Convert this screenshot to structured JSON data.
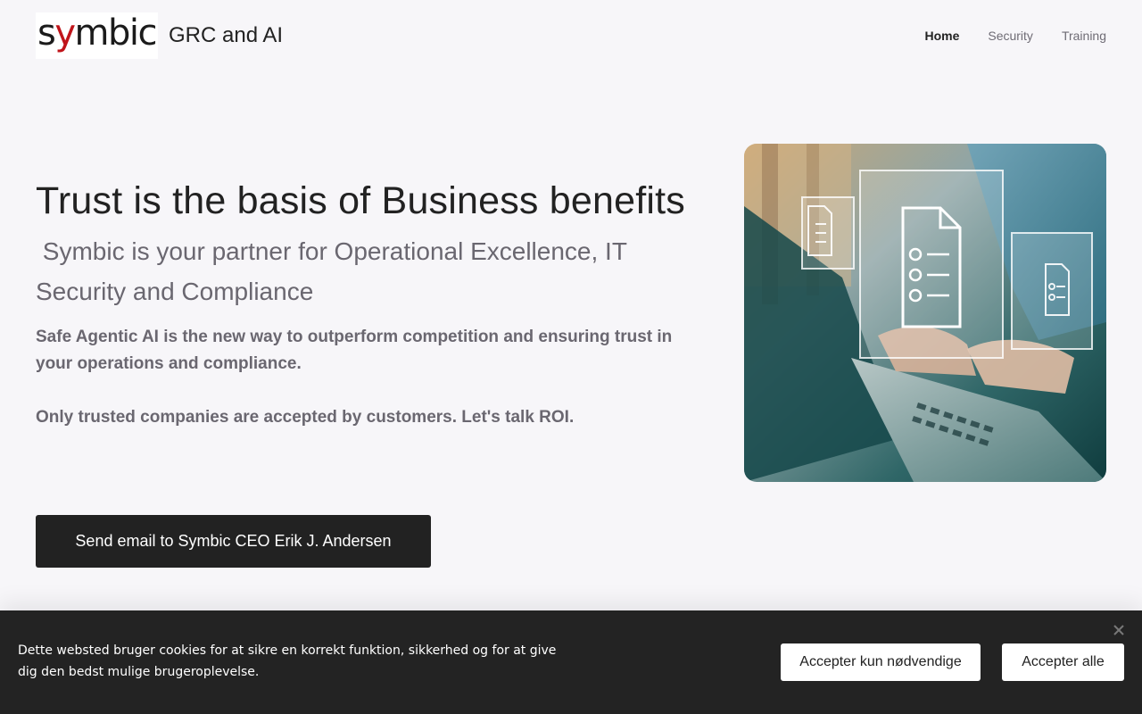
{
  "header": {
    "logo_text_prefix": "s",
    "logo_text_accent": "y",
    "logo_text_suffix": "mbic",
    "site_title": "GRC and AI"
  },
  "nav": {
    "items": [
      {
        "label": "Home",
        "active": true
      },
      {
        "label": "Security",
        "active": false
      },
      {
        "label": "Training",
        "active": false
      }
    ]
  },
  "hero": {
    "headline": "Trust is the basis of Business benefits",
    "subheadline": " Symbic is your partner for Operational Excellence, IT Security and Compliance",
    "body": "Safe Agentic AI is the new way to outperform competition and ensuring trust in your operations and compliance.",
    "body2": "Only trusted companies are accepted by customers. Let's talk ROI.",
    "cta_label": "Send email to Symbic CEO Erik J. Andersen"
  },
  "cookie_banner": {
    "text": "Dette websted bruger cookies for at sikre en korrekt funktion, sikkerhed og for at give dig den bedst mulige brugeroplevelse.",
    "necessary_label": "Accepter kun nødvendige",
    "all_label": "Accepter alle"
  },
  "colors": {
    "background": "#f7f6f9",
    "text_dark": "#222222",
    "text_muted": "#6a6770",
    "logo_accent": "#c0141a",
    "cookie_bg": "#232323"
  }
}
